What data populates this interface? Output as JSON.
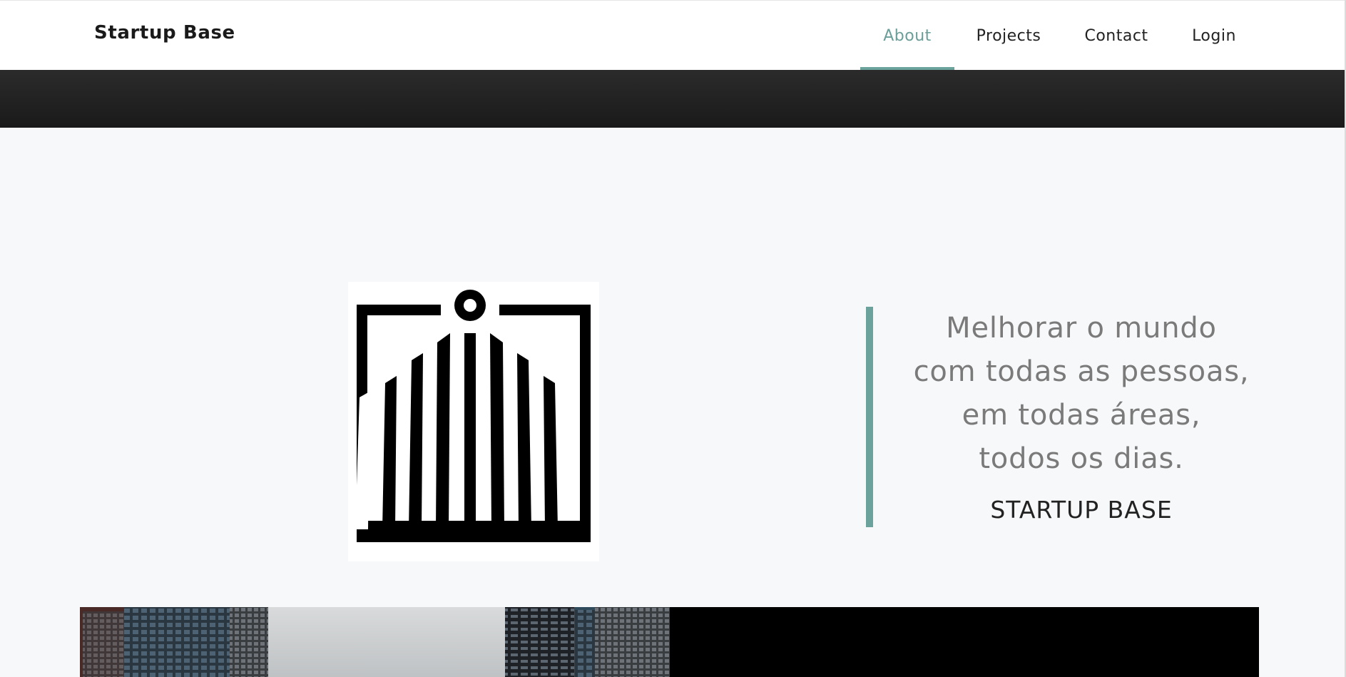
{
  "brand": {
    "name": "Startup Base"
  },
  "nav": {
    "items": [
      {
        "label": "About",
        "active": true
      },
      {
        "label": "Projects",
        "active": false
      },
      {
        "label": "Contact",
        "active": false
      },
      {
        "label": "Login",
        "active": false
      }
    ]
  },
  "hero": {
    "logo_icon": "building-gate-logo",
    "quote_lines": [
      "Melhorar o mundo",
      "com todas as pessoas,",
      "em todas áreas,",
      "todos os dias."
    ],
    "author": "STARTUP BASE"
  },
  "colors": {
    "accent": "#6ba39c",
    "nav_active_text": "#6b9e98",
    "dark_band": "#1f1f1f",
    "page_bg": "#f7f8f9"
  }
}
